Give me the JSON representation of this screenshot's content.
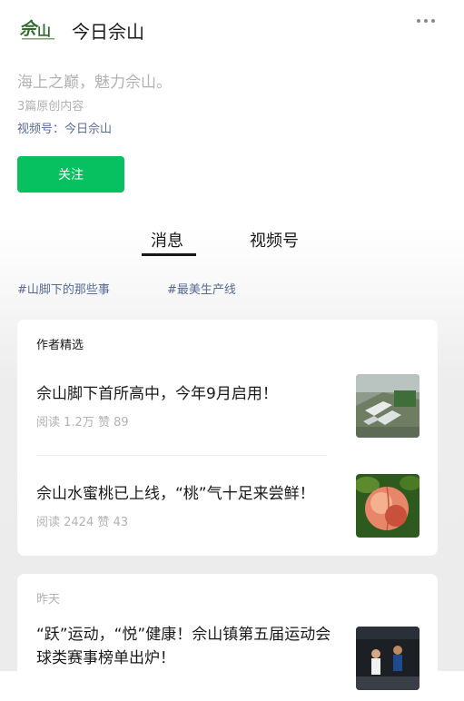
{
  "header": {
    "logo_text": "佘山",
    "title": "今日佘山",
    "more_icon": "more-horizontal-icon"
  },
  "profile": {
    "slogan": "海上之巅，魅力佘山。",
    "original_count": "3篇原创内容",
    "channel": "视频号：今日佘山",
    "follow_label": "关注"
  },
  "tabs": [
    {
      "label": "消息",
      "active": true
    },
    {
      "label": "视频号",
      "active": false
    }
  ],
  "tags": [
    "#山脚下的那些事",
    "#最美生产线"
  ],
  "picks": {
    "heading": "作者精选",
    "articles": [
      {
        "title": "佘山脚下首所高中，今年9月启用！",
        "meta": "阅读 1.2万  赞 89",
        "thumb": "aerial-school-photo"
      },
      {
        "title": "佘山水蜜桃已上线，“桃”气十足来尝鲜！",
        "meta": "阅读 2424  赞 43",
        "thumb": "peach-photo"
      }
    ]
  },
  "yesterday": {
    "heading": "昨天",
    "articles": [
      {
        "title": "“跃”运动，“悦”健康！佘山镇第五届运动会球类赛事榜单出炉！",
        "thumb": "basketball-photo"
      }
    ]
  },
  "colors": {
    "accent_green": "#07c160",
    "link_blue": "#576b95",
    "muted": "#b2b2b2"
  }
}
